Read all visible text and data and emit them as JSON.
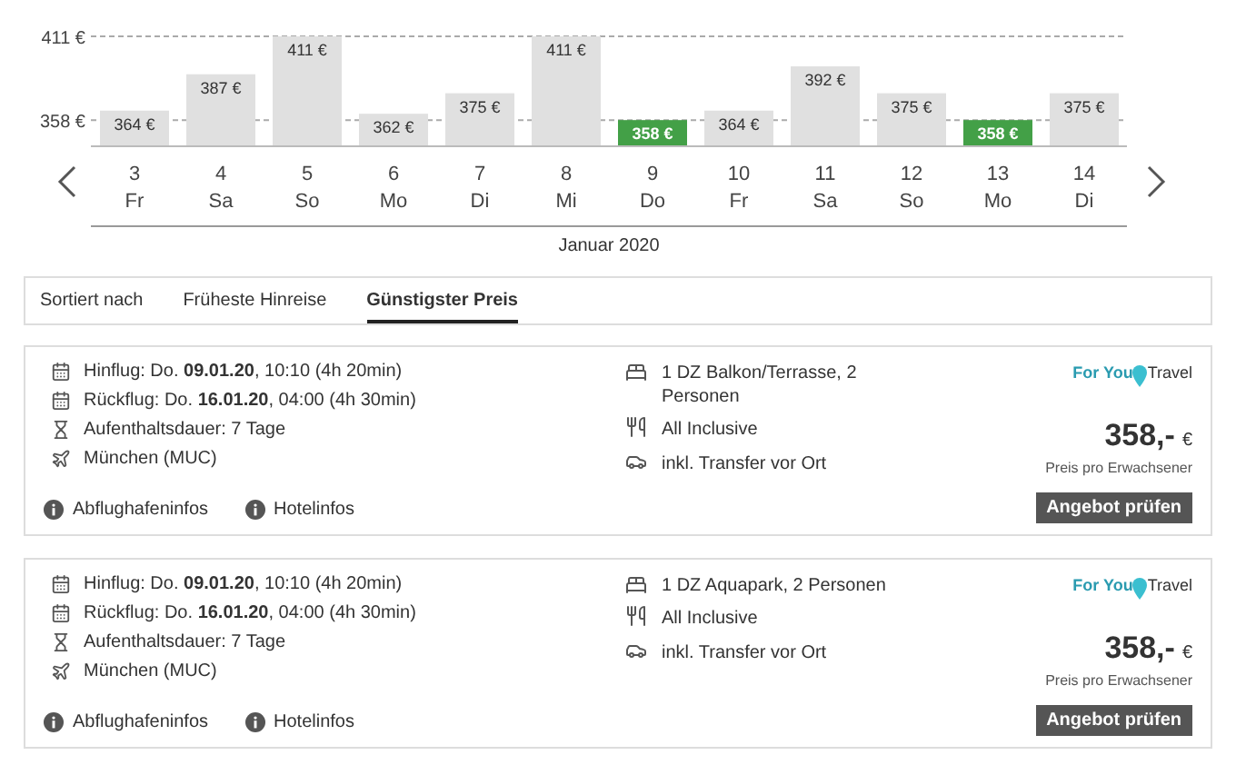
{
  "price_chart": {
    "chart_data": {
      "type": "bar",
      "categories": [
        "3",
        "4",
        "5",
        "6",
        "7",
        "8",
        "9",
        "10",
        "11",
        "12",
        "13",
        "14"
      ],
      "series": [
        {
          "values": [
            364,
            387,
            411,
            362,
            375,
            411,
            358,
            364,
            392,
            375,
            358,
            375
          ]
        }
      ],
      "ylim": [
        342,
        411
      ],
      "yticks": [
        {
          "value": 358,
          "label": "358 €"
        },
        {
          "value": 411,
          "label": "411 €"
        }
      ],
      "value_labels": [
        "364 €",
        "387 €",
        "411 €",
        "362 €",
        "375 €",
        "411 €",
        "358 €",
        "364 €",
        "392 €",
        "375 €",
        "358 €",
        "375 €"
      ]
    },
    "bars": [
      {
        "weekday": "Fr",
        "cheapest": false,
        "color": "#e0e0e0"
      },
      {
        "weekday": "Sa",
        "cheapest": false,
        "color": "#e0e0e0"
      },
      {
        "weekday": "So",
        "cheapest": false,
        "color": "#e0e0e0"
      },
      {
        "weekday": "Mo",
        "cheapest": false,
        "color": "#e0e0e0"
      },
      {
        "weekday": "Di",
        "cheapest": false,
        "color": "#e0e0e0"
      },
      {
        "weekday": "Mi",
        "cheapest": false,
        "color": "#e0e0e0"
      },
      {
        "weekday": "Do",
        "cheapest": true,
        "color": "#43a047"
      },
      {
        "weekday": "Fr",
        "cheapest": false,
        "color": "#e0e0e0"
      },
      {
        "weekday": "Sa",
        "cheapest": false,
        "color": "#e0e0e0"
      },
      {
        "weekday": "So",
        "cheapest": false,
        "color": "#e0e0e0"
      },
      {
        "weekday": "Mo",
        "cheapest": true,
        "color": "#43a047"
      },
      {
        "weekday": "Di",
        "cheapest": false,
        "color": "#e0e0e0"
      }
    ],
    "month": "Januar 2020"
  },
  "sort": {
    "label": "Sortiert nach",
    "options": [
      {
        "label": "Früheste Hinreise",
        "selected": false
      },
      {
        "label": "Günstigster Preis",
        "selected": true
      }
    ]
  },
  "offers": [
    {
      "details": [
        "Hinflug: Do. **09.01.20**, 10:10 (4h 20min)",
        "Rückflug: Do. **16.01.20**, 04:00 (4h 30min)",
        "Aufenthaltsdauer: 7 Tage",
        "München (MUC)"
      ],
      "room": "1 DZ Balkon/Terrasse, 2 Personen",
      "board": "All Inclusive",
      "transfer": "inkl. Transfer vor Ort",
      "provider": [
        "For You",
        "Travel"
      ],
      "price": "358,-",
      "currency": "€",
      "price_note": "Preis pro Erwachsener",
      "links": [
        "Abflughafeninfos",
        "Hotelinfos"
      ],
      "button": "Angebot prüfen"
    },
    {
      "details": [
        "Hinflug: Do. **09.01.20**, 10:10 (4h 20min)",
        "Rückflug: Do. **16.01.20**, 04:00 (4h 30min)",
        "Aufenthaltsdauer: 7 Tage",
        "München (MUC)"
      ],
      "room": "1 DZ Aquapark, 2 Personen",
      "board": "All Inclusive",
      "transfer": "inkl. Transfer vor Ort",
      "provider": [
        "For You",
        "Travel"
      ],
      "price": "358,-",
      "currency": "€",
      "price_note": "Preis pro Erwachsener",
      "links": [
        "Abflughafeninfos",
        "Hotelinfos"
      ],
      "button": "Angebot prüfen"
    }
  ]
}
